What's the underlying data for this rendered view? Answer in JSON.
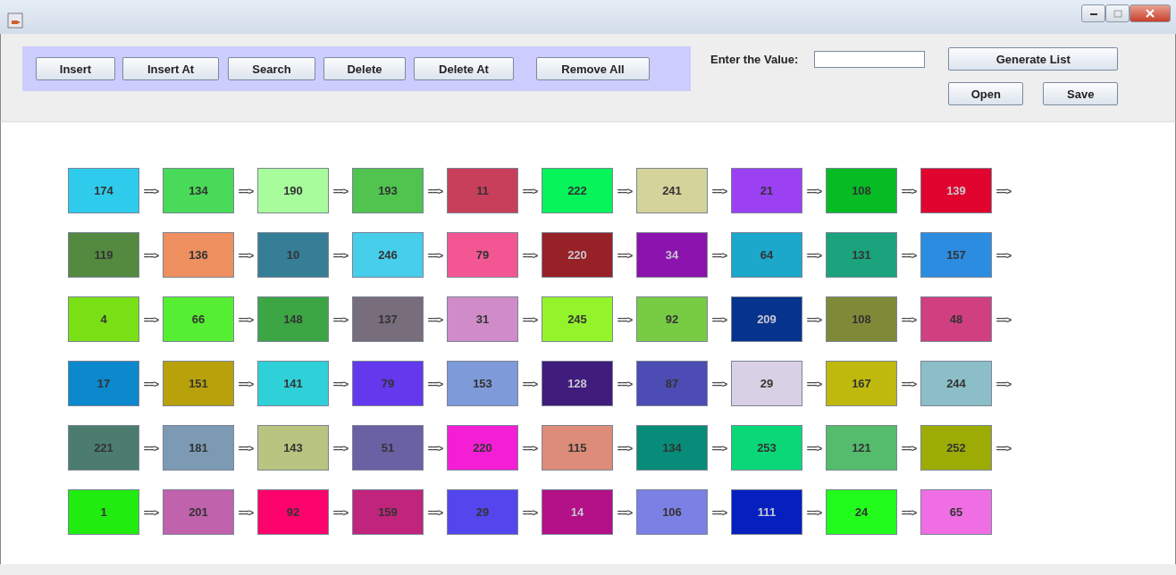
{
  "toolbar": {
    "buttons": [
      "Insert",
      "Insert At",
      "Search",
      "Delete",
      "Delete At",
      "Remove All"
    ]
  },
  "value_field": {
    "label": "Enter the Value:"
  },
  "actions": {
    "generate": "Generate List",
    "open": "Open",
    "save": "Save"
  },
  "list_rows": [
    [
      {
        "value": "174",
        "color": "#2ecbec",
        "link": "==>"
      },
      {
        "value": "134",
        "color": "#48da58",
        "link": "==>"
      },
      {
        "value": "190",
        "color": "#a8fc9c",
        "link": "==>"
      },
      {
        "value": "193",
        "color": "#50c44e",
        "link": "==>"
      },
      {
        "value": "11",
        "color": "#c83f5c",
        "link": "==>"
      },
      {
        "value": "222",
        "color": "#04f45a",
        "link": "==>"
      },
      {
        "value": "241",
        "color": "#d4d39a",
        "link": "==>"
      },
      {
        "value": "21",
        "color": "#9c40f4",
        "link": "==>"
      },
      {
        "value": "108",
        "color": "#06bb24",
        "link": "==>"
      },
      {
        "value": "139",
        "color": "#e0042e",
        "link": "==>"
      }
    ],
    [
      {
        "value": "119",
        "color": "#548a40",
        "link": "==>"
      },
      {
        "value": "136",
        "color": "#ee8f60",
        "link": "==>"
      },
      {
        "value": "10",
        "color": "#357e95",
        "link": "==>"
      },
      {
        "value": "246",
        "color": "#46ceeb",
        "link": "==>"
      },
      {
        "value": "79",
        "color": "#f35793",
        "link": "==>"
      },
      {
        "value": "220",
        "color": "#962126",
        "link": "==>"
      },
      {
        "value": "34",
        "color": "#8c13ad",
        "link": "==>"
      },
      {
        "value": "64",
        "color": "#1ba8cb",
        "link": "==>"
      },
      {
        "value": "131",
        "color": "#1aa37c",
        "link": "==>"
      },
      {
        "value": "157",
        "color": "#2c8ce0",
        "link": "==>"
      }
    ],
    [
      {
        "value": "4",
        "color": "#7ae016",
        "link": "==>"
      },
      {
        "value": "66",
        "color": "#56ee32",
        "link": "==>"
      },
      {
        "value": "148",
        "color": "#3ca544",
        "link": "==>"
      },
      {
        "value": "137",
        "color": "#786d7a",
        "link": "==>"
      },
      {
        "value": "31",
        "color": "#d08cc8",
        "link": "==>"
      },
      {
        "value": "245",
        "color": "#94f42c",
        "link": "==>"
      },
      {
        "value": "92",
        "color": "#78cc44",
        "link": "==>"
      },
      {
        "value": "209",
        "color": "#06338c",
        "link": "==>"
      },
      {
        "value": "108",
        "color": "#7f8a38",
        "link": "==>"
      },
      {
        "value": "48",
        "color": "#d04080",
        "link": "==>"
      }
    ],
    [
      {
        "value": "17",
        "color": "#0c88cc",
        "link": "==>"
      },
      {
        "value": "151",
        "color": "#b9a10c",
        "link": "==>"
      },
      {
        "value": "141",
        "color": "#30d0d8",
        "link": "==>"
      },
      {
        "value": "79",
        "color": "#6438ec",
        "link": "==>"
      },
      {
        "value": "153",
        "color": "#7f9ad8",
        "link": "==>"
      },
      {
        "value": "128",
        "color": "#401c7c",
        "link": "==>"
      },
      {
        "value": "87",
        "color": "#4c4cb4",
        "link": "==>"
      },
      {
        "value": "29",
        "color": "#d8d0e4",
        "link": "==>"
      },
      {
        "value": "167",
        "color": "#bfb90e",
        "link": "==>"
      },
      {
        "value": "244",
        "color": "#8cbec8",
        "link": "==>"
      }
    ],
    [
      {
        "value": "221",
        "color": "#4c7c6e",
        "link": "==>"
      },
      {
        "value": "181",
        "color": "#7c9ab4",
        "link": "==>"
      },
      {
        "value": "143",
        "color": "#b8c480",
        "link": "==>"
      },
      {
        "value": "51",
        "color": "#6a60a4",
        "link": "==>"
      },
      {
        "value": "220",
        "color": "#f41ed4",
        "link": "==>"
      },
      {
        "value": "115",
        "color": "#dc8c78",
        "link": "==>"
      },
      {
        "value": "134",
        "color": "#068c78",
        "link": "==>"
      },
      {
        "value": "253",
        "color": "#0ad878",
        "link": "==>"
      },
      {
        "value": "121",
        "color": "#54bc6c",
        "link": "==>"
      },
      {
        "value": "252",
        "color": "#9cac04",
        "link": "==>"
      }
    ],
    [
      {
        "value": "1",
        "color": "#20ec10",
        "link": "==>"
      },
      {
        "value": "201",
        "color": "#c062ac",
        "link": "==>"
      },
      {
        "value": "92",
        "color": "#fc046c",
        "link": "==>"
      },
      {
        "value": "159",
        "color": "#c0247c",
        "link": "==>"
      },
      {
        "value": "29",
        "color": "#5446ec",
        "link": "==>"
      },
      {
        "value": "14",
        "color": "#b41088",
        "link": "==>"
      },
      {
        "value": "106",
        "color": "#7a80e4",
        "link": "==>"
      },
      {
        "value": "111",
        "color": "#0620c0",
        "link": "==>"
      },
      {
        "value": "24",
        "color": "#22fc1c",
        "link": "==>"
      },
      {
        "value": "65",
        "color": "#f06ee4"
      }
    ]
  ]
}
